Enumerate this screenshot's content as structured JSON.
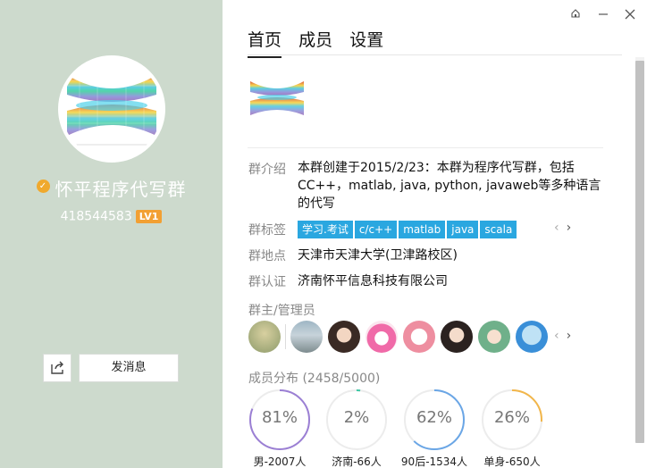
{
  "group": {
    "name": "怀平程序代写群",
    "id": "418544583",
    "level": "LV1"
  },
  "left_actions": {
    "send_message_label": "发消息"
  },
  "tabs": [
    {
      "label": "首页",
      "active": true
    },
    {
      "label": "成员",
      "active": false
    },
    {
      "label": "设置",
      "active": false
    }
  ],
  "info": {
    "intro_label": "群介绍",
    "intro_text": "本群创建于2015/2/23：本群为程序代写群，包括CC++，matlab, java, python, javaweb等多种语言的代写",
    "tags_label": "群标签",
    "tags": [
      "学习.考试",
      "c/c++",
      "matlab",
      "java",
      "scala"
    ],
    "location_label": "群地点",
    "location_value": "天津市天津大学(卫津路校区)",
    "cert_label": "群认证",
    "cert_value": "济南怀平信息科技有限公司"
  },
  "admins": {
    "title": "群主/管理员",
    "count": 8
  },
  "distribution": {
    "title": "成员分布",
    "count": "(2458/5000)",
    "stats": [
      {
        "pct": "81%",
        "value": 0.81,
        "label": "男-2007人",
        "color": "#9b7fd4"
      },
      {
        "pct": "2%",
        "value": 0.02,
        "label": "济南-66人",
        "color": "#3cc7a4"
      },
      {
        "pct": "62%",
        "value": 0.62,
        "label": "90后-1534人",
        "color": "#6aa6e6"
      },
      {
        "pct": "26%",
        "value": 0.26,
        "label": "单身-650人",
        "color": "#f2b64a"
      }
    ]
  },
  "colors": {
    "left_panel_bg": "#cddacd",
    "tag_bg": "#2aa7e0",
    "level_badge_bg": "#f2a033",
    "verified_badge": "#f0a92d"
  }
}
